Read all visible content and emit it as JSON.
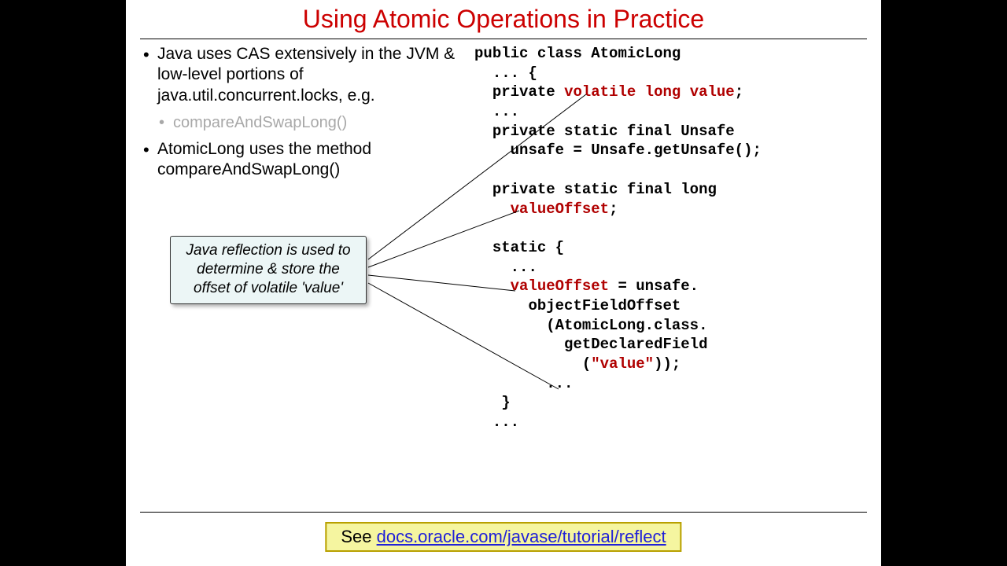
{
  "title": "Using Atomic Operations in Practice",
  "bullets": {
    "b1": "Java uses CAS extensively in the JVM & low-level portions of java.util.concurrent.locks, e.g.",
    "b1_sub1": "compareAndSwapLong()",
    "b2": "AtomicLong uses the method compareAndSwapLong()"
  },
  "callout": "Java reflection is used to determine & store the offset of volatile 'value'",
  "code": {
    "l1a": "public class AtomicLong",
    "l1b": "  ... {",
    "l2a": "  private ",
    "l2b": "volatile long value",
    "l2c": ";",
    "l3": "  ...",
    "l4": "  private static final Unsafe",
    "l5": "    unsafe = Unsafe.getUnsafe();",
    "l6": "",
    "l7": "  private static final long",
    "l8a": "    ",
    "l8b": "valueOffset",
    "l8c": ";",
    "l9": "",
    "l10": "  static {",
    "l11": "    ...",
    "l12a": "    ",
    "l12b": "valueOffset",
    "l12c": " = unsafe.",
    "l13": "      objectFieldOffset",
    "l14": "        (AtomicLong.class.",
    "l15": "          getDeclaredField",
    "l16a": "            (",
    "l16b": "\"value\"",
    "l16c": "));",
    "l17": "        ...",
    "l18": "   }",
    "l19": "  ..."
  },
  "footer": {
    "prefix": "See ",
    "link_text": "docs.oracle.com/javase/tutorial/reflect"
  }
}
